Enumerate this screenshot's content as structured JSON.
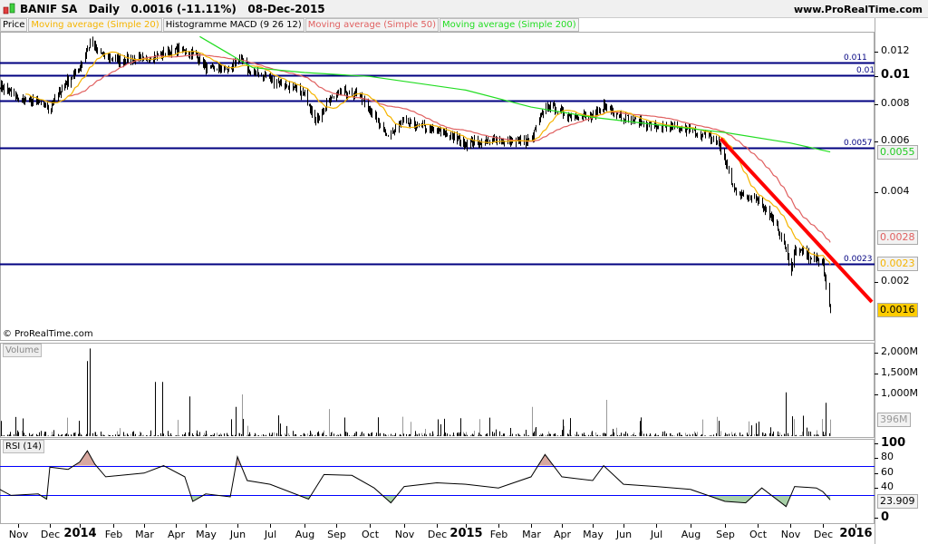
{
  "header": {
    "title": "BANIF SA   Daily   0.0016 (-11.11%)   08-Dec-2015",
    "site": "www.ProRealTime.com"
  },
  "legend": [
    "Price",
    "Moving average (Simple 20)",
    "Histogramme MACD (9 26 12)",
    "Moving average (Simple 50)",
    "Moving average (Simple 200)"
  ],
  "copyright": "© ProRealTime.com",
  "colors": {
    "ma20": "#f5b400",
    "ma50": "#e06060",
    "ma200": "#22dd22",
    "level": "#000080",
    "trend": "#ff0000",
    "rsi_line": "#000000",
    "rsi_band": "#0000ff"
  },
  "chart_data": [
    {
      "type": "ohlc",
      "title": "BANIF SA Daily",
      "scale": "log",
      "ylim": [
        0.0014,
        0.0145
      ],
      "y_ticks": [
        "0.012",
        "0.01",
        "0.008",
        "0.006",
        "0.004",
        "0.002"
      ],
      "price_labels": {
        "ma200": "0.0055",
        "ma50": "0.0028",
        "ma20": "0.0023",
        "last": "0.0016"
      },
      "levels": [
        {
          "value": 0.011,
          "label": "0.011"
        },
        {
          "value": 0.01,
          "label": "0.01"
        },
        {
          "value": 0.0082,
          "label": ""
        },
        {
          "value": 0.0057,
          "label": "0.0057"
        },
        {
          "value": 0.0023,
          "label": "0.0023"
        }
      ],
      "trendline": [
        [
          "2015-08-28",
          0.0061
        ],
        [
          "2015-12-31",
          0.00125
        ]
      ],
      "close": [
        [
          "2013-10-14",
          0.0092
        ],
        [
          "2013-11-01",
          0.0083
        ],
        [
          "2013-11-20",
          0.0081
        ],
        [
          "2013-12-01",
          0.0077
        ],
        [
          "2013-12-15",
          0.0092
        ],
        [
          "2014-01-01",
          0.0106
        ],
        [
          "2014-01-10",
          0.0128
        ],
        [
          "2014-01-20",
          0.0118
        ],
        [
          "2014-02-01",
          0.0113
        ],
        [
          "2014-03-01",
          0.0113
        ],
        [
          "2014-04-01",
          0.0122
        ],
        [
          "2014-04-20",
          0.0118
        ],
        [
          "2014-05-01",
          0.0106
        ],
        [
          "2014-05-25",
          0.0104
        ],
        [
          "2014-06-01",
          0.0115
        ],
        [
          "2014-06-10",
          0.0104
        ],
        [
          "2014-07-01",
          0.0097
        ],
        [
          "2014-08-01",
          0.0086
        ],
        [
          "2014-08-12",
          0.007
        ],
        [
          "2014-09-01",
          0.0088
        ],
        [
          "2014-09-20",
          0.0087
        ],
        [
          "2014-10-01",
          0.0077
        ],
        [
          "2014-10-15",
          0.0062
        ],
        [
          "2014-11-01",
          0.0069
        ],
        [
          "2014-12-01",
          0.0065
        ],
        [
          "2015-01-01",
          0.0059
        ],
        [
          "2015-02-01",
          0.006
        ],
        [
          "2015-03-01",
          0.006
        ],
        [
          "2015-03-10",
          0.0072
        ],
        [
          "2015-03-20",
          0.008
        ],
        [
          "2015-04-01",
          0.0074
        ],
        [
          "2015-05-01",
          0.0072
        ],
        [
          "2015-05-12",
          0.0079
        ],
        [
          "2015-06-01",
          0.0072
        ],
        [
          "2015-07-01",
          0.0067
        ],
        [
          "2015-08-01",
          0.0065
        ],
        [
          "2015-08-25",
          0.006
        ],
        [
          "2015-09-01",
          0.0051
        ],
        [
          "2015-09-10",
          0.004
        ],
        [
          "2015-10-01",
          0.0038
        ],
        [
          "2015-10-15",
          0.0033
        ],
        [
          "2015-10-28",
          0.0026
        ],
        [
          "2015-11-01",
          0.002
        ],
        [
          "2015-11-05",
          0.0026
        ],
        [
          "2015-12-01",
          0.0023
        ],
        [
          "2015-12-04",
          0.0019
        ],
        [
          "2015-12-08",
          0.0016
        ]
      ],
      "ma200": [
        [
          "2014-04-25",
          0.0135
        ],
        [
          "2014-06-15",
          0.0106
        ],
        [
          "2014-08-01",
          0.0102
        ],
        [
          "2014-10-01",
          0.0099
        ],
        [
          "2015-01-01",
          0.0089
        ],
        [
          "2015-03-01",
          0.0078
        ],
        [
          "2015-05-01",
          0.0072
        ],
        [
          "2015-07-01",
          0.0068
        ],
        [
          "2015-09-01",
          0.0064
        ],
        [
          "2015-11-01",
          0.0059
        ],
        [
          "2015-12-08",
          0.0055
        ]
      ]
    },
    {
      "type": "bar",
      "title": "Volume",
      "y_ticks": [
        "2,000M",
        "1,500M",
        "1,000M"
      ],
      "last_label": "396M",
      "ylim": [
        0,
        2200
      ],
      "spikes_millions": [
        [
          "2013-12-01",
          1150
        ],
        [
          "2013-12-28",
          1300
        ],
        [
          "2014-01-08",
          1800
        ],
        [
          "2014-01-10",
          2100
        ],
        [
          "2014-01-12",
          850
        ],
        [
          "2014-03-12",
          1300
        ],
        [
          "2014-03-19",
          1300
        ],
        [
          "2014-04-15",
          950
        ],
        [
          "2014-05-30",
          700
        ],
        [
          "2014-06-05",
          1000
        ],
        [
          "2014-08-25",
          650
        ],
        [
          "2015-03-02",
          700
        ],
        [
          "2015-05-15",
          870
        ],
        [
          "2015-10-28",
          1050
        ],
        [
          "2015-11-01",
          1000
        ],
        [
          "2015-12-04",
          800
        ],
        [
          "2015-12-08",
          396
        ]
      ]
    },
    {
      "type": "line",
      "title": "RSI (14)",
      "ylim": [
        0,
        100
      ],
      "bands": [
        30,
        70
      ],
      "y_ticks": [
        "100",
        "80",
        "60",
        "40",
        "0"
      ],
      "last_label": "23.909",
      "values": [
        [
          "2013-10-14",
          38
        ],
        [
          "2013-10-25",
          30
        ],
        [
          "2013-11-20",
          32
        ],
        [
          "2013-11-28",
          25
        ],
        [
          "2013-12-01",
          68
        ],
        [
          "2013-12-20",
          65
        ],
        [
          "2014-01-01",
          75
        ],
        [
          "2014-01-08",
          90
        ],
        [
          "2014-01-15",
          72
        ],
        [
          "2014-01-25",
          55
        ],
        [
          "2014-03-01",
          60
        ],
        [
          "2014-03-20",
          70
        ],
        [
          "2014-04-10",
          55
        ],
        [
          "2014-04-18",
          22
        ],
        [
          "2014-05-01",
          32
        ],
        [
          "2014-05-25",
          28
        ],
        [
          "2014-06-01",
          82
        ],
        [
          "2014-06-10",
          50
        ],
        [
          "2014-07-01",
          45
        ],
        [
          "2014-08-05",
          25
        ],
        [
          "2014-08-20",
          58
        ],
        [
          "2014-09-15",
          57
        ],
        [
          "2014-10-05",
          40
        ],
        [
          "2014-10-20",
          20
        ],
        [
          "2014-11-01",
          42
        ],
        [
          "2014-12-01",
          47
        ],
        [
          "2015-01-01",
          45
        ],
        [
          "2015-02-01",
          40
        ],
        [
          "2015-03-01",
          55
        ],
        [
          "2015-03-15",
          85
        ],
        [
          "2015-04-01",
          55
        ],
        [
          "2015-05-01",
          50
        ],
        [
          "2015-05-12",
          70
        ],
        [
          "2015-06-01",
          45
        ],
        [
          "2015-07-01",
          42
        ],
        [
          "2015-08-01",
          38
        ],
        [
          "2015-09-01",
          22
        ],
        [
          "2015-09-20",
          20
        ],
        [
          "2015-10-05",
          40
        ],
        [
          "2015-10-28",
          15
        ],
        [
          "2015-11-05",
          42
        ],
        [
          "2015-11-25",
          40
        ],
        [
          "2015-12-01",
          35
        ],
        [
          "2015-12-08",
          24
        ]
      ]
    }
  ],
  "x_axis": {
    "months": [
      [
        "2013-11-01",
        "Nov"
      ],
      [
        "2013-12-01",
        "Dec"
      ],
      [
        "2014-01-01",
        "2014"
      ],
      [
        "2014-02-01",
        "Feb"
      ],
      [
        "2014-03-01",
        "Mar"
      ],
      [
        "2014-04-01",
        "Apr"
      ],
      [
        "2014-05-01",
        "May"
      ],
      [
        "2014-06-01",
        "Jun"
      ],
      [
        "2014-07-01",
        "Jul"
      ],
      [
        "2014-08-01",
        "Aug"
      ],
      [
        "2014-09-01",
        "Sep"
      ],
      [
        "2014-10-01",
        "Oct"
      ],
      [
        "2014-11-01",
        "Nov"
      ],
      [
        "2014-12-01",
        "Dec"
      ],
      [
        "2015-01-01",
        "2015"
      ],
      [
        "2015-02-01",
        "Feb"
      ],
      [
        "2015-03-01",
        "Mar"
      ],
      [
        "2015-04-01",
        "Apr"
      ],
      [
        "2015-05-01",
        "May"
      ],
      [
        "2015-06-01",
        "Jun"
      ],
      [
        "2015-07-01",
        "Jul"
      ],
      [
        "2015-08-01",
        "Aug"
      ],
      [
        "2015-09-01",
        "Sep"
      ],
      [
        "2015-10-01",
        "Oct"
      ],
      [
        "2015-11-01",
        "Nov"
      ],
      [
        "2015-12-01",
        "Dec"
      ],
      [
        "2016-01-01",
        "2016"
      ]
    ]
  }
}
